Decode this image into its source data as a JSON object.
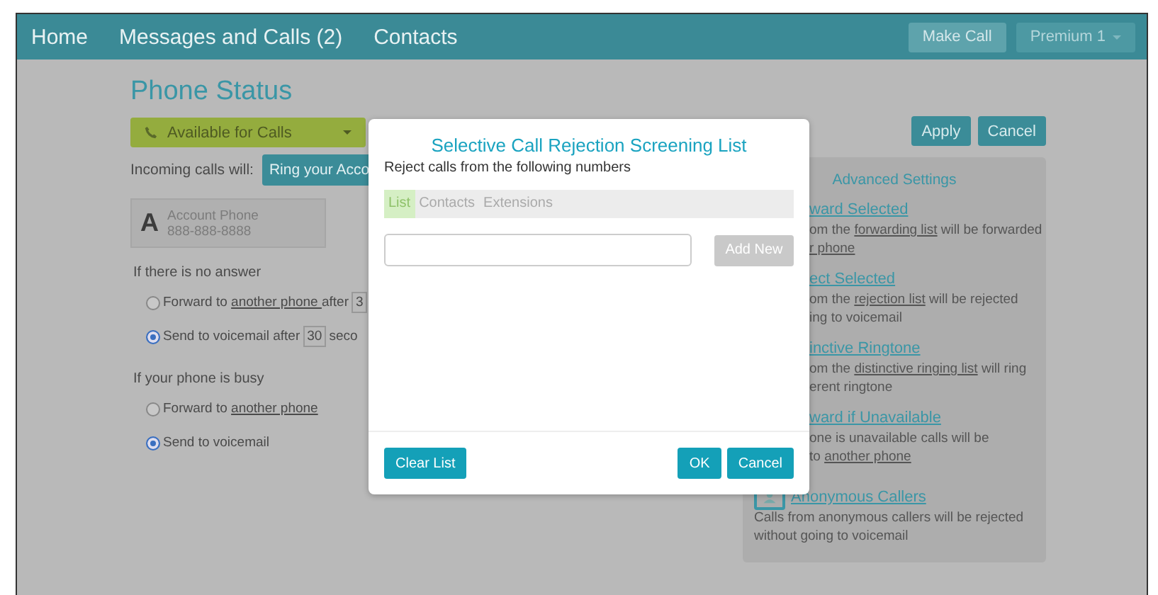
{
  "nav": {
    "links": [
      {
        "label": "Home"
      },
      {
        "label": "Messages and Calls (2)"
      },
      {
        "label": "Contacts"
      }
    ],
    "buttons": [
      {
        "label": "Make Call",
        "kind": "button"
      },
      {
        "label": "Premium 1",
        "kind": "dropdown"
      }
    ]
  },
  "page": {
    "title": "Phone Status",
    "status": {
      "label": "Available for Calls"
    },
    "actions": [
      "Apply",
      "Cancel"
    ],
    "incoming_label": "Incoming calls will:",
    "incoming_button": "Ring your Acco",
    "account": {
      "letter": "A",
      "name": "Account Phone",
      "number": "888-888-8888"
    },
    "sections": [
      {
        "heading": "If there is no answer",
        "options": [
          {
            "selected": false,
            "parts": [
              {
                "text": "Forward to "
              },
              {
                "text": "another phone ",
                "link": true
              },
              {
                "text": "after"
              }
            ],
            "field": "3"
          },
          {
            "selected": true,
            "parts": [
              {
                "text": "Send to voicemail after"
              }
            ],
            "field": "30",
            "suffix": "seco"
          }
        ]
      },
      {
        "heading": "If your phone is busy",
        "options": [
          {
            "selected": false,
            "parts": [
              {
                "text": "Forward to "
              },
              {
                "text": "another phone",
                "link": true
              }
            ]
          },
          {
            "selected": true,
            "parts": [
              {
                "text": "Send to voicemail"
              }
            ]
          }
        ]
      }
    ]
  },
  "advanced": {
    "title": "Advanced Settings",
    "items": [
      {
        "title": "ward Selected",
        "icon": false,
        "lines": [
          [
            {
              "text": "om the "
            },
            {
              "text": "forwarding list",
              "link": true
            },
            {
              "text": " will be forwarded"
            }
          ],
          [
            {
              "text": "r phone",
              "link": true
            }
          ]
        ]
      },
      {
        "title": "ect Selected",
        "icon": false,
        "lines": [
          [
            {
              "text": "om the "
            },
            {
              "text": "rejection list",
              "link": true
            },
            {
              "text": " will be rejected"
            }
          ],
          [
            {
              "text": "ing to voicemail"
            }
          ]
        ]
      },
      {
        "title": "inctive Ringtone",
        "icon": false,
        "lines": [
          [
            {
              "text": "om the "
            },
            {
              "text": "distinctive ringing list",
              "link": true
            },
            {
              "text": " will ring"
            }
          ],
          [
            {
              "text": "erent ringtone"
            }
          ]
        ]
      },
      {
        "title": "ward if Unavailable",
        "icon": false,
        "lines": [
          [
            {
              "text": "one is unavailable calls will be"
            }
          ],
          [
            {
              "text": "to "
            },
            {
              "text": "another phone",
              "link": true
            }
          ]
        ]
      },
      {
        "title": "Anonymous Callers",
        "icon": true,
        "lines": [
          [
            {
              "text": "Calls from anonymous callers will be rejected"
            }
          ],
          [
            {
              "text": "without going to voicemail"
            }
          ]
        ]
      }
    ]
  },
  "dialog": {
    "title": "Selective Call Rejection Screening List",
    "subtitle": "Reject calls from the following numbers",
    "tabs": [
      {
        "label": "List",
        "selected": true
      },
      {
        "label": "Contacts",
        "selected": false
      },
      {
        "label": "Extensions",
        "selected": false
      }
    ],
    "add_button": {
      "label": "Add New",
      "disabled": true
    },
    "footer_left": "Clear List",
    "footer_right": [
      "OK",
      "Cancel"
    ]
  }
}
